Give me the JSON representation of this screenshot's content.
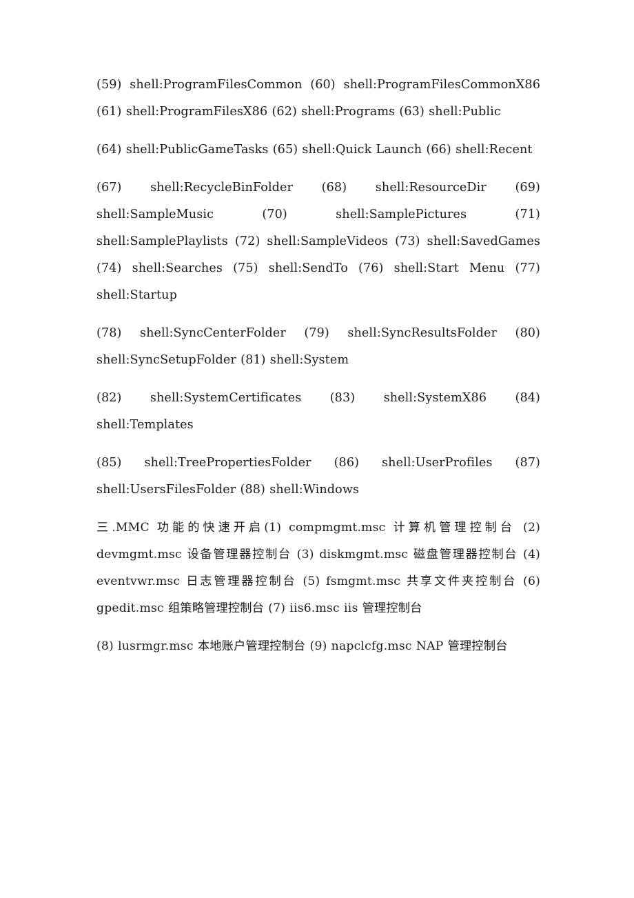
{
  "document": {
    "page_background": "#ffffff",
    "text_color": "#1c1c1c",
    "paragraphs": [
      {
        "id": "p1",
        "name": "shell-commands-59-63",
        "text": "(59)  shell:ProgramFilesCommon  (60)  shell:ProgramFilesCommonX86 (61)  shell:ProgramFilesX86  (62)  shell:Programs  (63) shell:Public"
      },
      {
        "id": "p2",
        "name": "shell-commands-64-66",
        "text": "(64)  shell:PublicGameTasks  (65)  shell:Quick  Launch  (66) shell:Recent"
      },
      {
        "id": "p3",
        "name": "shell-commands-67-77",
        "text": "(67)  shell:RecycleBinFolder  (68)  shell:ResourceDir  (69) shell:SampleMusic  (70)  shell:SamplePictures  (71) shell:SamplePlaylists  (72)  shell:SampleVideos  (73) shell:SavedGames  (74)  shell:Searches  (75)  shell:SendTo  (76) shell:Start Menu (77) shell:Startup"
      },
      {
        "id": "p4",
        "name": "shell-commands-78-81",
        "text": "(78)  shell:SyncCenterFolder  (79)  shell:SyncResultsFolder  (80) shell:SyncSetupFolder (81) shell:System"
      },
      {
        "id": "p5",
        "name": "shell-commands-82-84",
        "text": "(82)  shell:SystemCertificates  (83)  shell:SystemX86  (84) shell:Templates"
      },
      {
        "id": "p6",
        "name": "shell-commands-85-88",
        "text": "(85)  shell:TreePropertiesFolder  (86)  shell:UserProfiles  (87) shell:UsersFilesFolder (88) shell:Windows"
      },
      {
        "id": "p7",
        "name": "mmc-section-heading-and-items-1-7",
        "text": "三.MMC 功能的快速开启(1) compmgmt.msc 计算机管理控制台 (2) devmgmt.msc 设备管理器控制台 (3) diskmgmt.msc 磁盘管理器控制台 (4) eventvwr.msc 日志管理器控制台 (5) fsmgmt.msc 共享文件夹控制台 (6) gpedit.msc 组策略管理控制台 (7) iis6.msc iis 管理控制台"
      },
      {
        "id": "p8",
        "name": "mmc-items-8-9",
        "text": "(8) lusrmgr.msc 本地账户管理控制台 (9) napclcfg.msc NAP 管理控制台"
      }
    ]
  }
}
